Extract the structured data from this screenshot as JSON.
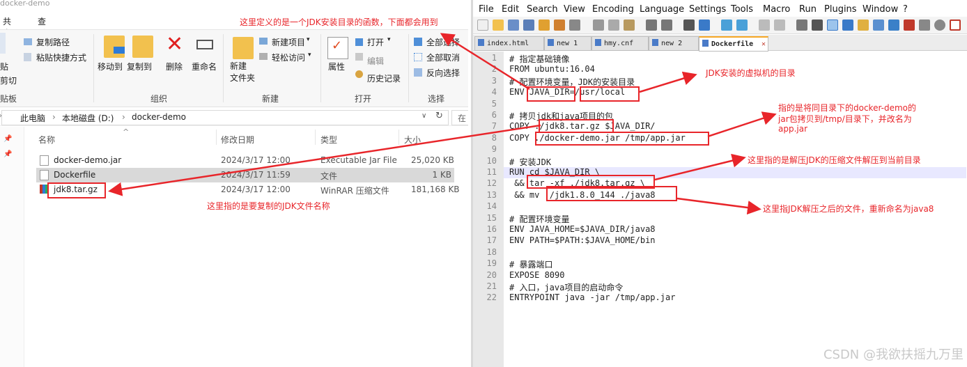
{
  "explorer": {
    "window_title": "docker-demo",
    "tabs": [
      "共享",
      "查看"
    ],
    "ribbon": {
      "clipboard": {
        "paste": "贴",
        "cut": "剪切",
        "group": "贴板"
      },
      "copy_path": "复制路径",
      "paste_shortcut": "粘贴快捷方式",
      "move_to": "移动到",
      "copy_to": "复制到",
      "delete": "删除",
      "rename": "重命名",
      "organize_group": "组织",
      "new_folder": "新建\n文件夹",
      "new_item": "新建项目",
      "easy_access": "轻松访问",
      "new_group": "新建",
      "properties": "属性",
      "open": "打开",
      "edit": "编辑",
      "history": "历史记录",
      "open_group": "打开",
      "select_all": "全部选择",
      "select_none": "全部取消",
      "invert_selection": "反向选择",
      "select_group": "选择"
    },
    "breadcrumb": [
      "此电脑",
      "本地磁盘 (D:)",
      "docker-demo"
    ],
    "search_placeholder": "在",
    "columns": {
      "name": "名称",
      "date": "修改日期",
      "type": "类型",
      "size": "大小"
    },
    "files": [
      {
        "name": "docker-demo.jar",
        "date": "2024/3/17 12:00",
        "type": "Executable Jar File",
        "size": "25,020 KB"
      },
      {
        "name": "Dockerfile",
        "date": "2024/3/17 11:59",
        "type": "文件",
        "size": "1 KB"
      },
      {
        "name": "jdk8.tar.gz",
        "date": "2024/3/17 12:00",
        "type": "WinRAR 压缩文件",
        "size": "181,168 KB"
      }
    ]
  },
  "npp": {
    "menu": [
      "File",
      "Edit",
      "Search",
      "View",
      "Encoding",
      "Language",
      "Settings",
      "Tools",
      "Macro",
      "Run",
      "Plugins",
      "Window",
      "?"
    ],
    "tabs": [
      {
        "label": "index.html",
        "active": false
      },
      {
        "label": "new 1",
        "active": false
      },
      {
        "label": "hmy.cnf",
        "active": false
      },
      {
        "label": "new 2",
        "active": false
      },
      {
        "label": "Dockerfile",
        "active": true
      }
    ],
    "lines": [
      "# 指定基础镜像",
      "FROM ubuntu:16.04",
      "# 配置环境变量，JDK的安装目录",
      "ENV JAVA_DIR=/usr/local",
      "",
      "# 拷贝jdk和java项目的包",
      "COPY ./jdk8.tar.gz $JAVA_DIR/",
      "COPY ./docker-demo.jar /tmp/app.jar",
      "",
      "# 安装JDK",
      "RUN cd $JAVA_DIR \\",
      " && tar -xf ./jdk8.tar.gz \\",
      " && mv ./jdk1.8.0_144 ./java8",
      "",
      "# 配置环境变量",
      "ENV JAVA_HOME=$JAVA_DIR/java8",
      "ENV PATH=$PATH:$JAVA_HOME/bin",
      "",
      "# 暴露端口",
      "EXPOSE 8090",
      "# 入口，java项目的启动命令",
      "ENTRYPOINT java -jar /tmp/app.jar"
    ],
    "line_numbers": [
      "1",
      "2",
      "3",
      "4",
      "5",
      "6",
      "7",
      "8",
      "9",
      "10",
      "11",
      "12",
      "13",
      "14",
      "15",
      "16",
      "17",
      "18",
      "19",
      "20",
      "21",
      "22"
    ]
  },
  "annotations": {
    "a1": "这里定义的是一个JDK安装目录的函数，下面都会用到",
    "a2": "JDK安装的虚拟机的目录",
    "a3_1": "指的是将同目录下的docker-demo的",
    "a3_2": "jar包拷贝到/tmp/目录下，并改名为",
    "a3_3": "app.jar",
    "a4": "这里指的是解压JDK的压缩文件解压到当前目录",
    "a5": "这里指JDK解压之后的文件，重新命名为java8",
    "a6": "这里指的是要复制的JDK文件名称"
  },
  "watermark": "CSDN @我欲扶摇九万里",
  "colors": {
    "annotation": "#e8252a",
    "tab_accent": "#f5a623",
    "current_line": "#e8e8ff"
  }
}
